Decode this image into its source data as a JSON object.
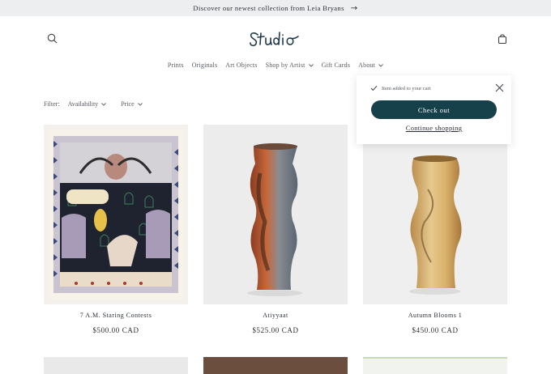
{
  "announcement": {
    "text": "Discover our newest collection from Leia Bryans",
    "arrow_icon": "arrow-right-icon"
  },
  "header": {
    "logo_text": "Studio",
    "search_icon": "search-icon",
    "cart_icon": "cart-icon"
  },
  "nav": {
    "items": [
      {
        "label": "Prints",
        "dropdown": false
      },
      {
        "label": "Originals",
        "dropdown": false
      },
      {
        "label": "Art Objects",
        "dropdown": false
      },
      {
        "label": "Shop by Artist",
        "dropdown": true
      },
      {
        "label": "Gift Cards",
        "dropdown": false
      },
      {
        "label": "About",
        "dropdown": true
      }
    ]
  },
  "filter": {
    "label": "Filter:",
    "options": [
      "Availability",
      "Price"
    ]
  },
  "products": [
    {
      "title": "7 A.M. Staring Contests",
      "price": "$500.00 CAD"
    },
    {
      "title": "Atiyyaat",
      "price": "$525.00 CAD"
    },
    {
      "title": "Autumn Blooms 1",
      "price": "$450.00 CAD"
    }
  ],
  "cart_popup": {
    "message": "Item added to your cart",
    "checkout_label": "Check out",
    "continue_label": "Continue shopping"
  },
  "colors": {
    "accent": "#17414a",
    "announce_bg": "#eceef0"
  }
}
